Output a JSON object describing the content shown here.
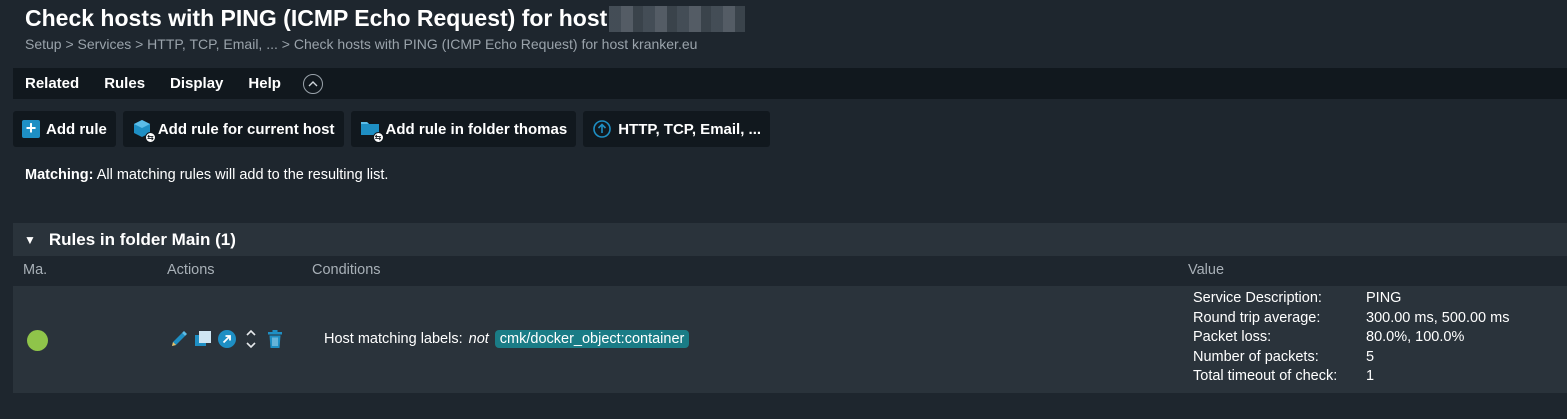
{
  "page": {
    "title": "Check hosts with PING (ICMP Echo Request) for host",
    "breadcrumb": "Setup > Services > HTTP, TCP, Email, ... > Check hosts with PING (ICMP Echo Request) for host kranker.eu"
  },
  "menu": {
    "items": [
      "Related",
      "Rules",
      "Display",
      "Help"
    ],
    "toggle_icon": "chevron-up-circle-icon"
  },
  "toolbar": {
    "add_rule": "Add rule",
    "add_rule_current_host": "Add rule for current host",
    "add_rule_folder": "Add rule in folder thomas",
    "parent": "HTTP, TCP, Email, ..."
  },
  "matching": {
    "label": "Matching:",
    "text": " All matching rules will add to the resulting list."
  },
  "folder": {
    "title": "Rules in folder Main (1)",
    "columns": {
      "match": "Ma.",
      "actions": "Actions",
      "conditions": "Conditions",
      "value": "Value"
    },
    "rule": {
      "status": "match",
      "status_color": "#8fc44a",
      "condition_label": "Host matching labels:",
      "condition_op": "not",
      "condition_value": "cmk/docker_object:container",
      "values": [
        {
          "key": "Service Description:",
          "val": "PING"
        },
        {
          "key": "Round trip average:",
          "val": "300.00 ms, 500.00 ms"
        },
        {
          "key": "Packet loss:",
          "val": "80.0%, 100.0%"
        },
        {
          "key": "Number of packets:",
          "val": "5"
        },
        {
          "key": "Total timeout of check:",
          "val": "1"
        }
      ]
    }
  },
  "colors": {
    "background": "#1e262e",
    "panel": "#2a333b",
    "accent": "#1e8fc4",
    "label_chip": "#1a7c86"
  }
}
